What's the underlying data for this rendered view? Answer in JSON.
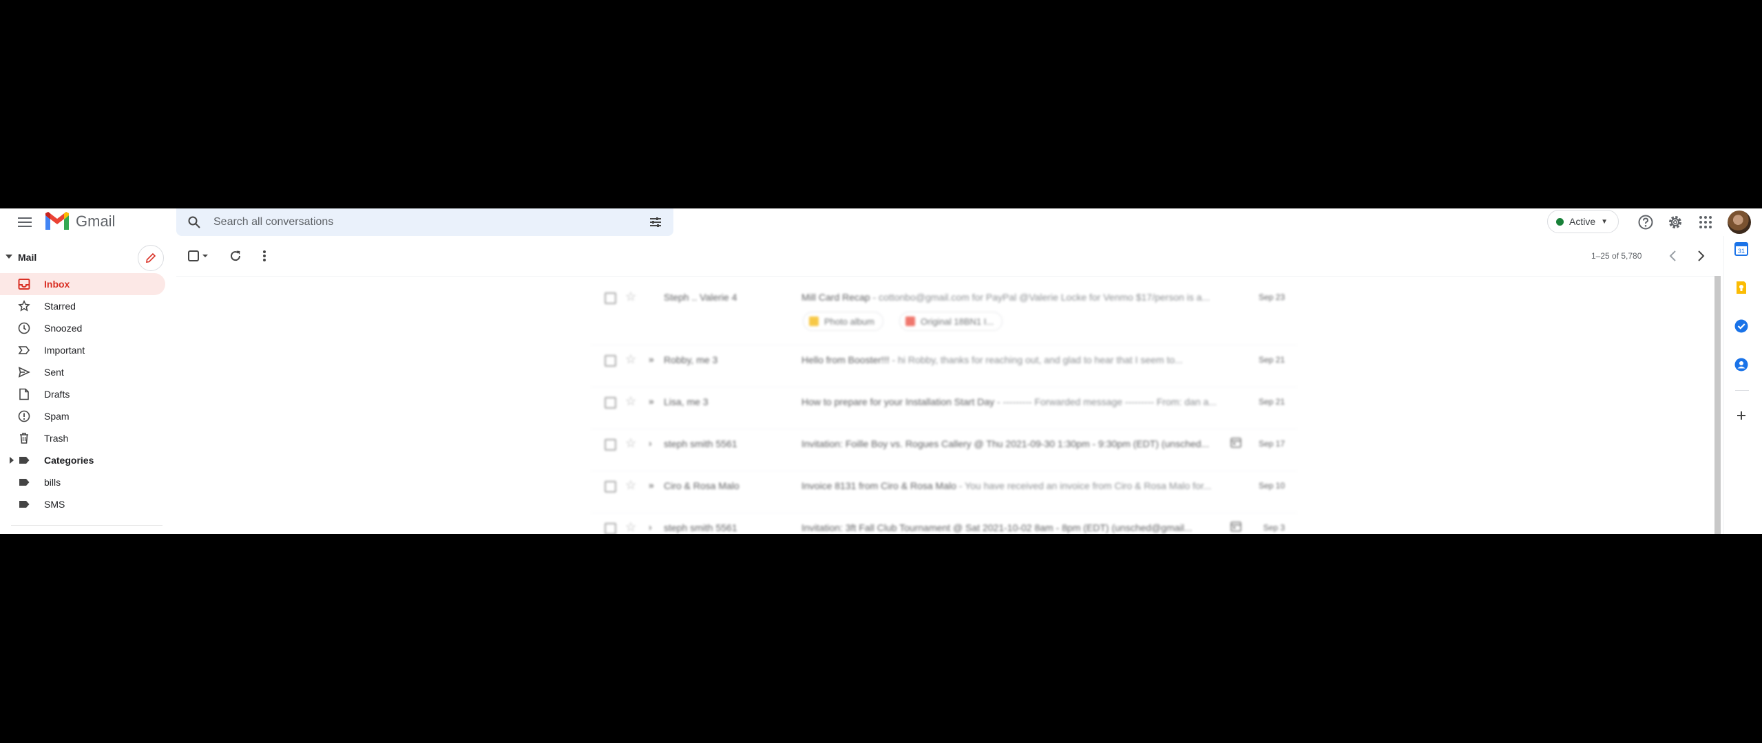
{
  "app": {
    "name": "Gmail"
  },
  "search": {
    "placeholder": "Search all conversations"
  },
  "status": {
    "label": "Active"
  },
  "sidebar": {
    "section_label": "Mail",
    "items": [
      {
        "label": "Inbox",
        "icon": "inbox-icon",
        "active": true
      },
      {
        "label": "Starred",
        "icon": "star-icon"
      },
      {
        "label": "Snoozed",
        "icon": "clock-icon"
      },
      {
        "label": "Important",
        "icon": "important-icon"
      },
      {
        "label": "Sent",
        "icon": "send-icon"
      },
      {
        "label": "Drafts",
        "icon": "draft-icon"
      },
      {
        "label": "Spam",
        "icon": "spam-icon"
      },
      {
        "label": "Trash",
        "icon": "trash-icon"
      },
      {
        "label": "Categories",
        "icon": "label-icon",
        "expandable": true
      },
      {
        "label": "bills",
        "icon": "label-icon"
      },
      {
        "label": "SMS",
        "icon": "label-icon"
      }
    ]
  },
  "toolbar": {
    "pager": "1–25 of 5,780"
  },
  "messages": [
    {
      "sender": "Steph .. Valerie 4",
      "subject": "Mill Card Recap",
      "snippet": " - cottonbo@gmail.com for PayPal @Valerie Locke for Venmo $17/person is a...",
      "date": "Sep 23",
      "important": false,
      "calendar": false,
      "attachments": [
        {
          "label": "Photo album",
          "color": "#f4b400"
        },
        {
          "label": "Original 18BN1 I...",
          "color": "#ea4335"
        }
      ]
    },
    {
      "sender": "Robby, me 3",
      "subject": "Hello from Booster!!!",
      "snippet": " - hi Robby, thanks for reaching out, and glad to hear that I seem to...",
      "date": "Sep 21",
      "important": true,
      "calendar": false
    },
    {
      "sender": "Lisa, me 3",
      "subject": "How to prepare for your Installation Start Day",
      "snippet": " - --------- Forwarded message --------- From: dan a...",
      "date": "Sep 21",
      "important": true,
      "calendar": false
    },
    {
      "sender": "steph smith 5561",
      "subject": "Invitation: Foille Boy vs. Rogues Callery @ Thu 2021-09-30 1:30pm - 9:30pm (EDT) (unsched...",
      "snippet": "",
      "date": "Sep 17",
      "important": false,
      "calendar": true
    },
    {
      "sender": "Ciro & Rosa Malo",
      "subject": "Invoice 8131 from Ciro & Rosa Malo",
      "snippet": " - You have received an invoice from Ciro & Rosa Malo for...",
      "date": "Sep 10",
      "important": true,
      "calendar": false
    },
    {
      "sender": "steph smith 5561",
      "subject": "Invitation: 3ft Fall Club Tournament @ Sat 2021-10-02 8am - 8pm (EDT) (unsched@gmail...",
      "snippet": "",
      "date": "Sep 3",
      "important": false,
      "calendar": true
    }
  ],
  "colors": {
    "accent": "#d93025",
    "active_bg": "#fce8e6",
    "search_bg": "#eaf1fb",
    "status_green": "#188038"
  }
}
